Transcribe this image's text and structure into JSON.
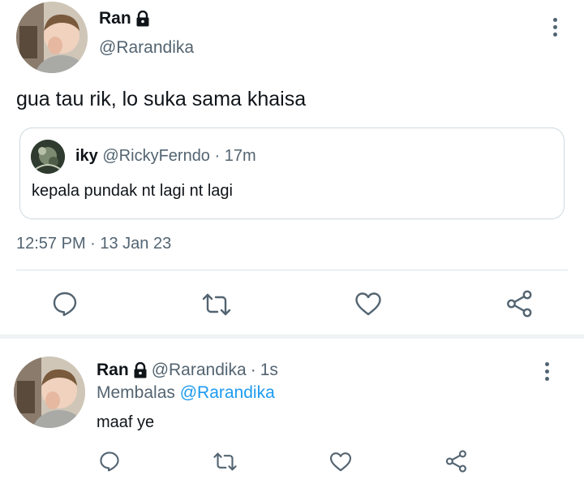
{
  "main_tweet": {
    "author_name": "Ran",
    "author_handle": "@Rarandika",
    "locked_icon": "lock-icon",
    "text": "gua tau rik, lo suka sama khaisa",
    "quoted": {
      "author_name": "iky",
      "author_handle": "@RickyFerndo",
      "separator": "·",
      "time": "17m",
      "text": "kepala pundak nt lagi nt lagi"
    },
    "timestamp": "12:57 PM · 13 Jan 23",
    "actions": [
      "reply-icon",
      "retweet-icon",
      "like-icon",
      "share-icon"
    ]
  },
  "reply_tweet": {
    "author_name": "Ran",
    "author_handle": "@Rarandika",
    "separator": "·",
    "time": "1s",
    "replying_prefix": "Membalas",
    "replying_handle": "@Rarandika",
    "text": "maaf ye",
    "actions": [
      "reply-icon",
      "retweet-icon",
      "like-icon",
      "share-icon"
    ]
  },
  "colors": {
    "text": "#0f1419",
    "muted": "#536471",
    "link": "#1d9bf0",
    "border": "#cfd9de"
  }
}
